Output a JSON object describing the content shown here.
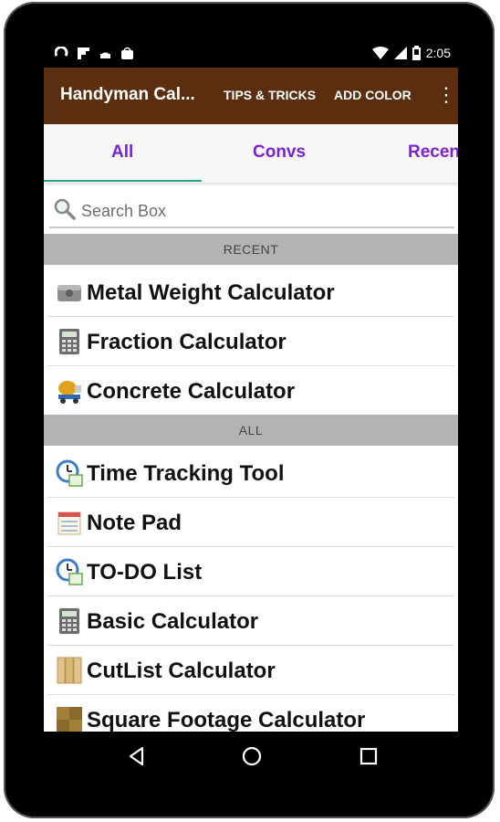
{
  "status_bar": {
    "time": "2:05"
  },
  "app_bar": {
    "title": "Handyman Cal...",
    "actions": [
      "TIPS & TRICKS",
      "ADD COLOR"
    ]
  },
  "tabs": [
    {
      "label": "All"
    },
    {
      "label": "Convs"
    },
    {
      "label": "Recen"
    }
  ],
  "search": {
    "placeholder": "Search Box"
  },
  "sections": {
    "recent_header": "RECENT",
    "recent_items": [
      {
        "label": "Metal Weight Calculator",
        "icon": "metal-weight-icon"
      },
      {
        "label": "Fraction Calculator",
        "icon": "calculator-icon"
      },
      {
        "label": "Concrete Calculator",
        "icon": "concrete-mixer-icon"
      }
    ],
    "all_header": "ALL",
    "all_items": [
      {
        "label": "Time Tracking Tool",
        "icon": "clock-icon"
      },
      {
        "label": "Note Pad",
        "icon": "notepad-icon"
      },
      {
        "label": "TO-DO List",
        "icon": "clock-icon"
      },
      {
        "label": "Basic Calculator",
        "icon": "calculator-icon"
      },
      {
        "label": "CutList Calculator",
        "icon": "wood-planks-icon"
      },
      {
        "label": "Square Footage Calculator",
        "icon": "floor-tiles-icon"
      }
    ]
  },
  "colors": {
    "app_bar": "#5a2e0e",
    "tab_text": "#7b22d4",
    "tab_indicator": "#2aa189",
    "section_header": "#b3b3b3"
  }
}
